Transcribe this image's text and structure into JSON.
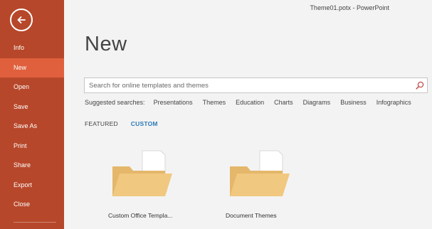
{
  "window": {
    "title": "Theme01.potx - PowerPoint"
  },
  "sidebar": {
    "back_icon": "back-arrow-icon",
    "items": [
      {
        "label": "Info",
        "active": false
      },
      {
        "label": "New",
        "active": true
      },
      {
        "label": "Open",
        "active": false
      },
      {
        "label": "Save",
        "active": false
      },
      {
        "label": "Save As",
        "active": false
      },
      {
        "label": "Print",
        "active": false
      },
      {
        "label": "Share",
        "active": false
      },
      {
        "label": "Export",
        "active": false
      },
      {
        "label": "Close",
        "active": false
      }
    ]
  },
  "main": {
    "title": "New",
    "search": {
      "placeholder": "Search for online templates and themes",
      "value": "",
      "icon": "search-icon"
    },
    "suggested": {
      "label": "Suggested searches:",
      "links": [
        "Presentations",
        "Themes",
        "Education",
        "Charts",
        "Diagrams",
        "Business",
        "Infographics"
      ]
    },
    "tabs": [
      {
        "label": "FEATURED",
        "active": false
      },
      {
        "label": "CUSTOM",
        "active": true
      }
    ],
    "tiles": [
      {
        "label": "Custom Office Templa...",
        "icon": "folder-icon"
      },
      {
        "label": "Document Themes",
        "icon": "folder-icon"
      }
    ]
  },
  "colors": {
    "sidebar": "#b7472a",
    "sidebar_active": "#e0603d",
    "accent": "#2b7bb9",
    "folder": "#f1c87f"
  }
}
